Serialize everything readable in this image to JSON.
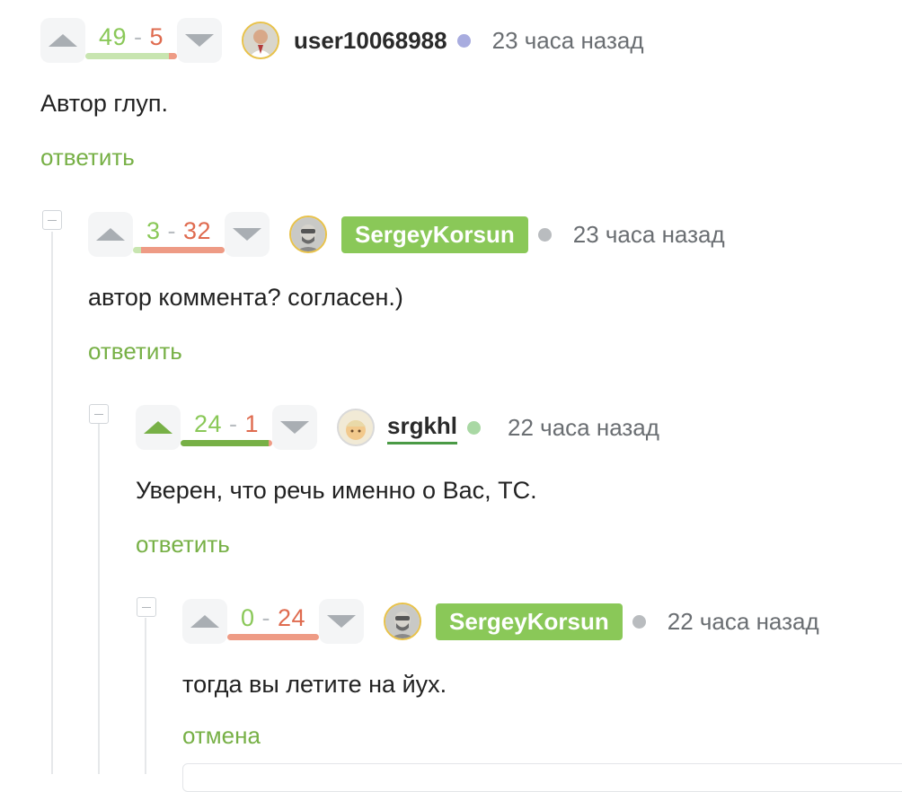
{
  "comments": [
    {
      "rating_plus": "49",
      "rating_minus": "5",
      "plus_fraction": 0.91,
      "username": "user10068988",
      "status_color": "#a8acdf",
      "time": "23 часа назад",
      "text": "Автор глуп.",
      "action": "ответить"
    },
    {
      "rating_plus": "3",
      "rating_minus": "32",
      "plus_fraction": 0.09,
      "username": "SergeyKorsun",
      "status_color": "#b9bcbf",
      "time": "23 часа назад",
      "text": "автор коммента? согласен.)",
      "action": "ответить"
    },
    {
      "rating_plus": "24",
      "rating_minus": "1",
      "plus_fraction": 0.96,
      "username": "srgkhl",
      "status_color": "#a9d8a4",
      "time": "22 часа назад",
      "text": "Уверен, что речь именно о Вас, ТС.",
      "action": "ответить"
    },
    {
      "rating_plus": "0",
      "rating_minus": "24",
      "plus_fraction": 0.0,
      "username": "SergeyKorsun",
      "status_color": "#b9bcbf",
      "time": "22 часа назад",
      "text": "тогда вы летите на йух.",
      "action": "отмена"
    }
  ],
  "separator": "-",
  "colors": {
    "accent": "#77b046",
    "plus": "#8ac858",
    "minus": "#df6b4f",
    "badge": "#8ac858"
  },
  "icons": {
    "upvote": "triangle-up-icon",
    "downvote": "triangle-down-icon",
    "collapse": "minus-square-icon"
  }
}
